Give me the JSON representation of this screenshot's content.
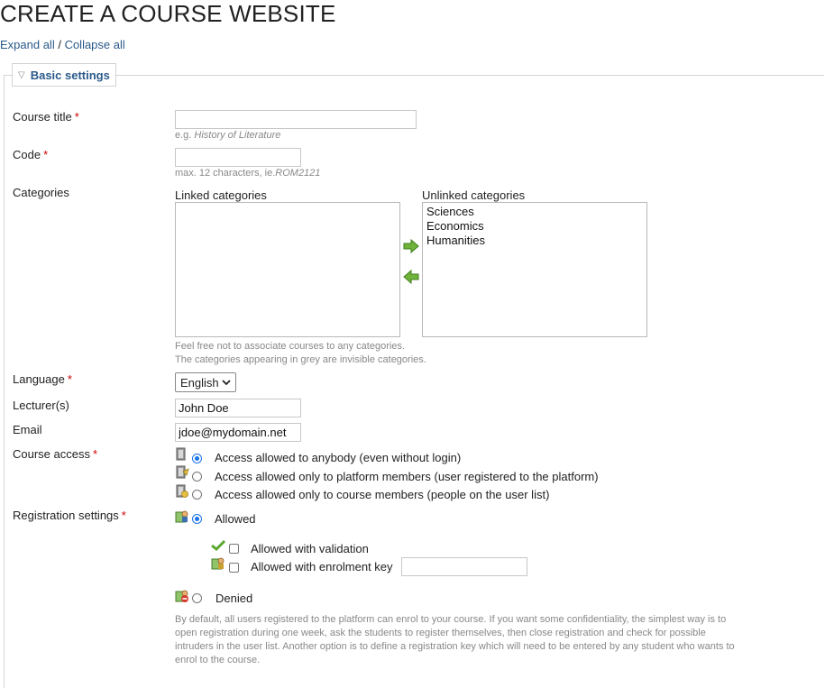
{
  "page": {
    "title": "CREATE A COURSE WEBSITE",
    "expand_all": "Expand all",
    "separator": " / ",
    "collapse_all": "Collapse all"
  },
  "section": {
    "legend": "Basic settings"
  },
  "fields": {
    "course_title": {
      "label": "Course title",
      "required": "*",
      "value": "",
      "hint_prefix": "e.g. ",
      "hint_example": "History of Literature"
    },
    "code": {
      "label": "Code",
      "required": "*",
      "value": "",
      "hint_prefix": "max. 12 characters, ie.",
      "hint_example": "ROM2121"
    },
    "categories": {
      "label": "Categories",
      "linked_label": "Linked categories",
      "unlinked_label": "Unlinked categories",
      "linked": [],
      "unlinked": [
        "Sciences",
        "Economics",
        "Humanities"
      ],
      "hint_line1": "Feel free not to associate courses to any categories.",
      "hint_line2": "The categories appearing in grey are invisible categories."
    },
    "language": {
      "label": "Language",
      "required": "*",
      "selected": "English"
    },
    "lecturers": {
      "label": "Lecturer(s)",
      "value": "John Doe"
    },
    "email": {
      "label": "Email",
      "value": "jdoe@mydomain.net"
    },
    "course_access": {
      "label": "Course access",
      "required": "*",
      "options": [
        {
          "text": "Access allowed to anybody (even without login)",
          "checked": true,
          "icon": "public-access-icon"
        },
        {
          "text": "Access allowed only to platform members (user registered to the platform)",
          "checked": false,
          "icon": "platform-access-icon"
        },
        {
          "text": "Access allowed only to course members (people on the user list)",
          "checked": false,
          "icon": "course-access-icon"
        }
      ]
    },
    "registration": {
      "label": "Registration settings",
      "required": "*",
      "allowed": "Allowed",
      "with_validation": "Allowed with validation",
      "with_key": "Allowed with enrolment key",
      "key_value": "",
      "denied": "Denied",
      "note": "By default, all users registered to the platform can enrol to your course. If you want some confidentiality, the simplest way is to open registration during one week, ask the students to register themselves, then close registration and check for possible intruders in the user list. Another option is to define a registration key which will need to be entered by any student who wants to enrol to the course."
    }
  },
  "colors": {
    "link": "#2b5a8a",
    "required": "#cc0000",
    "hint": "#888888",
    "arrow_green": "#6fb33a",
    "radio_accent": "#1a73e8"
  }
}
